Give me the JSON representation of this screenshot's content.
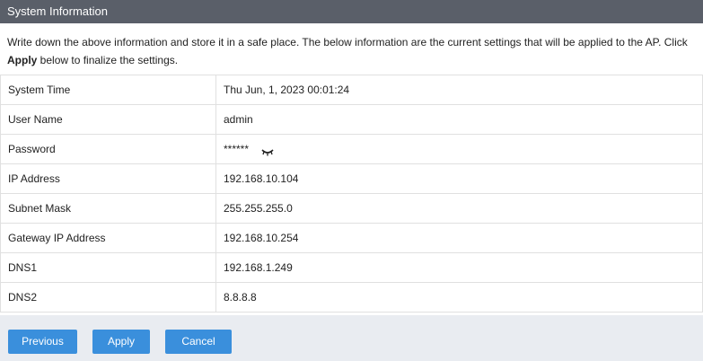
{
  "header": {
    "title": "System Information"
  },
  "description": {
    "text_before": "Write down the above information and store it in a safe place. The below information are the current settings that will be applied to the AP. Click ",
    "bold": "Apply",
    "text_after": " below to finalize the settings."
  },
  "rows": [
    {
      "label": "System Time",
      "value": "Thu Jun, 1, 2023 00:01:24"
    },
    {
      "label": "User Name",
      "value": "admin"
    },
    {
      "label": "Password",
      "value": "******"
    },
    {
      "label": "IP Address",
      "value": "192.168.10.104"
    },
    {
      "label": "Subnet Mask",
      "value": "255.255.255.0"
    },
    {
      "label": "Gateway IP Address",
      "value": "192.168.10.254"
    },
    {
      "label": "DNS1",
      "value": "192.168.1.249"
    },
    {
      "label": "DNS2",
      "value": "8.8.8.8"
    }
  ],
  "buttons": {
    "previous": "Previous",
    "apply": "Apply",
    "cancel": "Cancel"
  },
  "colors": {
    "header_bg": "#5a5f69",
    "button_bg": "#3a8fdc",
    "footer_bg": "#e9ecf1"
  },
  "icons": {
    "password_toggle": "eye-closed-icon"
  }
}
